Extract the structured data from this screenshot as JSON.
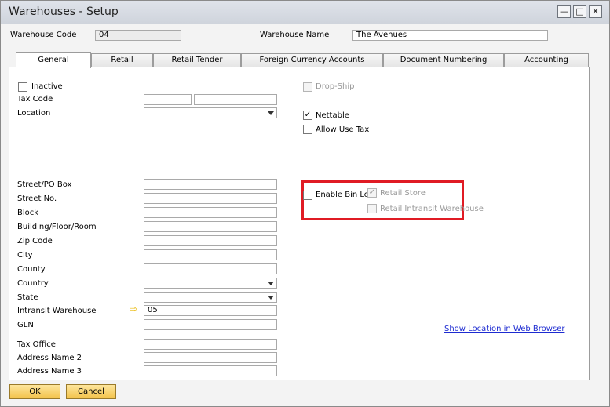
{
  "window": {
    "title": "Warehouses - Setup",
    "min": "—",
    "max": "□",
    "close": "✕"
  },
  "header": {
    "warehouse_code_label": "Warehouse Code",
    "warehouse_code_value": "04",
    "warehouse_name_label": "Warehouse Name",
    "warehouse_name_value": "The Avenues"
  },
  "tabs": [
    "General",
    "Retail",
    "Retail Tender",
    "Foreign Currency Accounts",
    "Document Numbering",
    "Accounting"
  ],
  "left": {
    "inactive": "Inactive",
    "tax_code": "Tax Code",
    "location": "Location",
    "street_po_box": "Street/PO Box",
    "street_no": "Street No.",
    "block": "Block",
    "building": "Building/Floor/Room",
    "zip": "Zip Code",
    "city": "City",
    "county": "County",
    "country": "Country",
    "state": "State",
    "intransit_warehouse": "Intransit Warehouse",
    "intransit_value": "05",
    "gln": "GLN",
    "tax_office": "Tax Office",
    "address_name_2": "Address Name 2",
    "address_name_3": "Address Name 3"
  },
  "right": {
    "drop_ship": "Drop-Ship",
    "nettable": "Nettable",
    "allow_use_tax": "Allow Use Tax",
    "enable_bin": "Enable Bin Lo",
    "retail_store": "Retail Store",
    "retail_intransit": "Retail Intransit Warehouse",
    "web_link": "Show Location in Web Browser",
    "check_mark": "✓"
  },
  "footer": {
    "ok": "OK",
    "cancel": "Cancel"
  },
  "arrow_glyph": "⇨"
}
